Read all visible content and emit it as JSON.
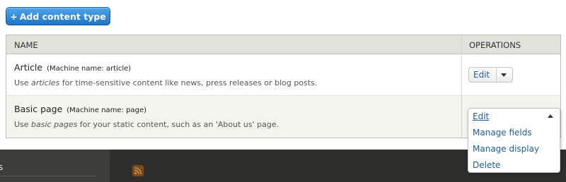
{
  "toolbar": {
    "add_button_icon": "+",
    "add_button_label": "Add content type"
  },
  "table": {
    "headers": {
      "name": "NAME",
      "operations": "OPERATIONS"
    },
    "rows": [
      {
        "title": "Article",
        "machine_name": "(Machine name: article)",
        "desc_before": "Use ",
        "desc_em": "articles",
        "desc_after": " for time-sensitive content like news, press releases or blog posts.",
        "operation_label": "Edit"
      },
      {
        "title": "Basic page",
        "machine_name": "(Machine name: page)",
        "desc_before": "Use ",
        "desc_em": "basic pages",
        "desc_after": " for your static content, such as an 'About us' page."
      }
    ]
  },
  "dropdown": {
    "items": [
      "Edit",
      "Manage fields",
      "Manage display",
      "Delete"
    ]
  },
  "footer": {
    "heading_fragment": "s",
    "icon": "rss-icon"
  },
  "colors": {
    "primary_button": "#1d74c7",
    "link": "#1a5fa0",
    "header_bg": "#e1e2dc",
    "footer_bg": "#2e2e2c"
  }
}
